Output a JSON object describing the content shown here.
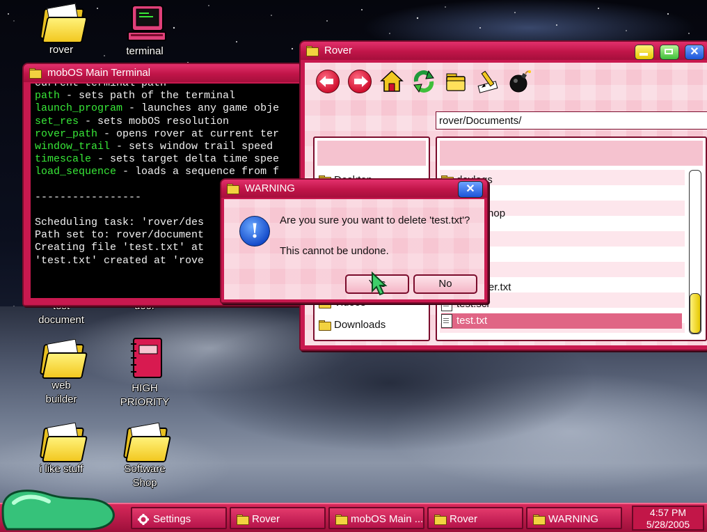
{
  "desktop": {
    "icons": [
      {
        "label": "rover"
      },
      {
        "label": "terminal"
      },
      {
        "label": "test",
        "label2": "document"
      },
      {
        "label": "door"
      },
      {
        "label": "web",
        "label2": "builder"
      },
      {
        "label": "HIGH",
        "label2": "PRIORITY"
      },
      {
        "label": "i like stuff"
      },
      {
        "label": "Software",
        "label2": "Shop"
      }
    ]
  },
  "terminal": {
    "title": "mobOS Main Terminal",
    "lines": [
      {
        "cmd": "",
        "text": "current terminal path"
      },
      {
        "cmd": "path",
        "text": " - sets path of the terminal"
      },
      {
        "cmd": "launch_program",
        "text": " - launches any game obje"
      },
      {
        "cmd": "set_res",
        "text": " - sets mobOS resolution"
      },
      {
        "cmd": "rover_path",
        "text": " - opens rover at current ter"
      },
      {
        "cmd": "window_trail",
        "text": " - sets window trail speed"
      },
      {
        "cmd": "timescale",
        "text": " - sets target delta time spee"
      },
      {
        "cmd": "load_sequence",
        "text": " - loads a sequence from f"
      },
      {
        "cmd": "",
        "text": ""
      },
      {
        "cmd": "",
        "text": "-----------------"
      },
      {
        "cmd": "",
        "text": ""
      },
      {
        "cmd": "",
        "text": "Scheduling task: 'rover/des"
      },
      {
        "cmd": "",
        "text": "Path set to: rover/document"
      },
      {
        "cmd": "",
        "text": "Creating file 'test.txt' at"
      },
      {
        "cmd": "",
        "text": "'test.txt' created at 'rove"
      }
    ]
  },
  "rover": {
    "title": "Rover",
    "address": "rover/Documents/",
    "toolbar": [
      "back-icon",
      "forward-icon",
      "home-icon",
      "refresh-icon",
      "new-folder-icon",
      "rename-icon",
      "delete-bomb-icon"
    ],
    "left_items": [
      {
        "label": "Desktop"
      },
      {
        "label": "Videos"
      },
      {
        "label": "Downloads"
      }
    ],
    "files": [
      {
        "label": "devlogs",
        "kind": "folder"
      },
      {
        "label": "photoshop",
        "kind": "folder"
      },
      {
        "label": "reminder.txt",
        "kind": "file"
      },
      {
        "label": "test.scr",
        "kind": "file"
      },
      {
        "label": "test.txt",
        "kind": "file",
        "selected": true
      }
    ]
  },
  "warning": {
    "title": "WARNING",
    "message": "Are you sure you want to delete 'test.txt'?",
    "submessage": "This cannot be undone.",
    "yes": "Yes",
    "no": "No",
    "close": "✕"
  },
  "taskbar": {
    "items": [
      {
        "label": "Settings",
        "icon": "gear-icon"
      },
      {
        "label": "Rover",
        "icon": "folder-icon"
      },
      {
        "label": "mobOS Main ...",
        "icon": "folder-icon"
      },
      {
        "label": "Rover",
        "icon": "folder-icon"
      },
      {
        "label": "WARNING",
        "icon": "folder-icon"
      }
    ],
    "time": "4:57 PM",
    "date": "5/28/2005"
  },
  "colors": {
    "window": "#c8194f",
    "pink_panel": "#f7c6d2",
    "terminal_cmd": "#38e838",
    "selection": "#e06585"
  }
}
